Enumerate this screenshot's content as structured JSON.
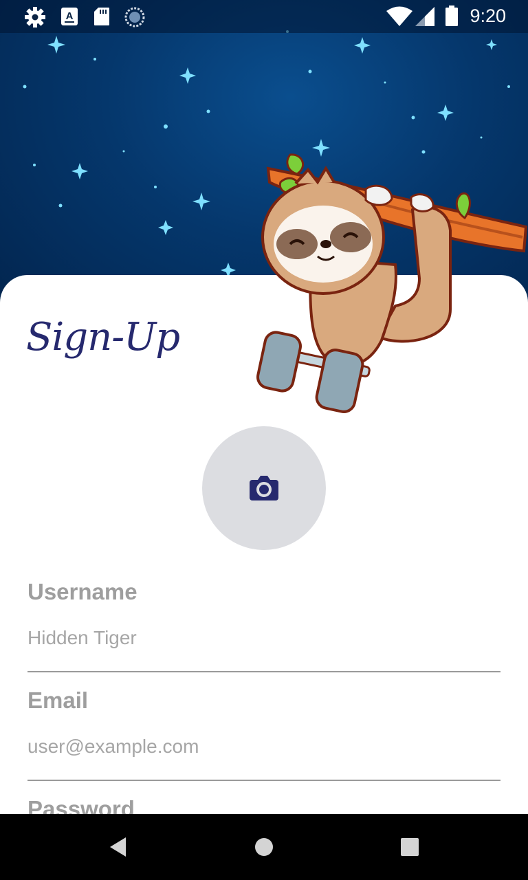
{
  "status_bar": {
    "time": "9:20",
    "icons": [
      "gear-icon",
      "a-notification-icon",
      "sd-card-icon",
      "sync-circle-icon",
      "wifi-icon",
      "signal-icon",
      "battery-icon"
    ]
  },
  "header": {
    "title": "Sign-Up"
  },
  "avatar": {
    "icon": "camera-icon"
  },
  "form": {
    "username_label": "Username",
    "username_placeholder": "Hidden Tiger",
    "email_label": "Email",
    "email_placeholder": "user@example.com",
    "password_label": "Password"
  },
  "nav": {
    "buttons": [
      "back-icon",
      "home-icon",
      "recents-icon"
    ]
  },
  "colors": {
    "title": "#26296e",
    "sky": "#05376c",
    "avatar_bg": "#dcdde1",
    "label": "#9e9e9e"
  }
}
